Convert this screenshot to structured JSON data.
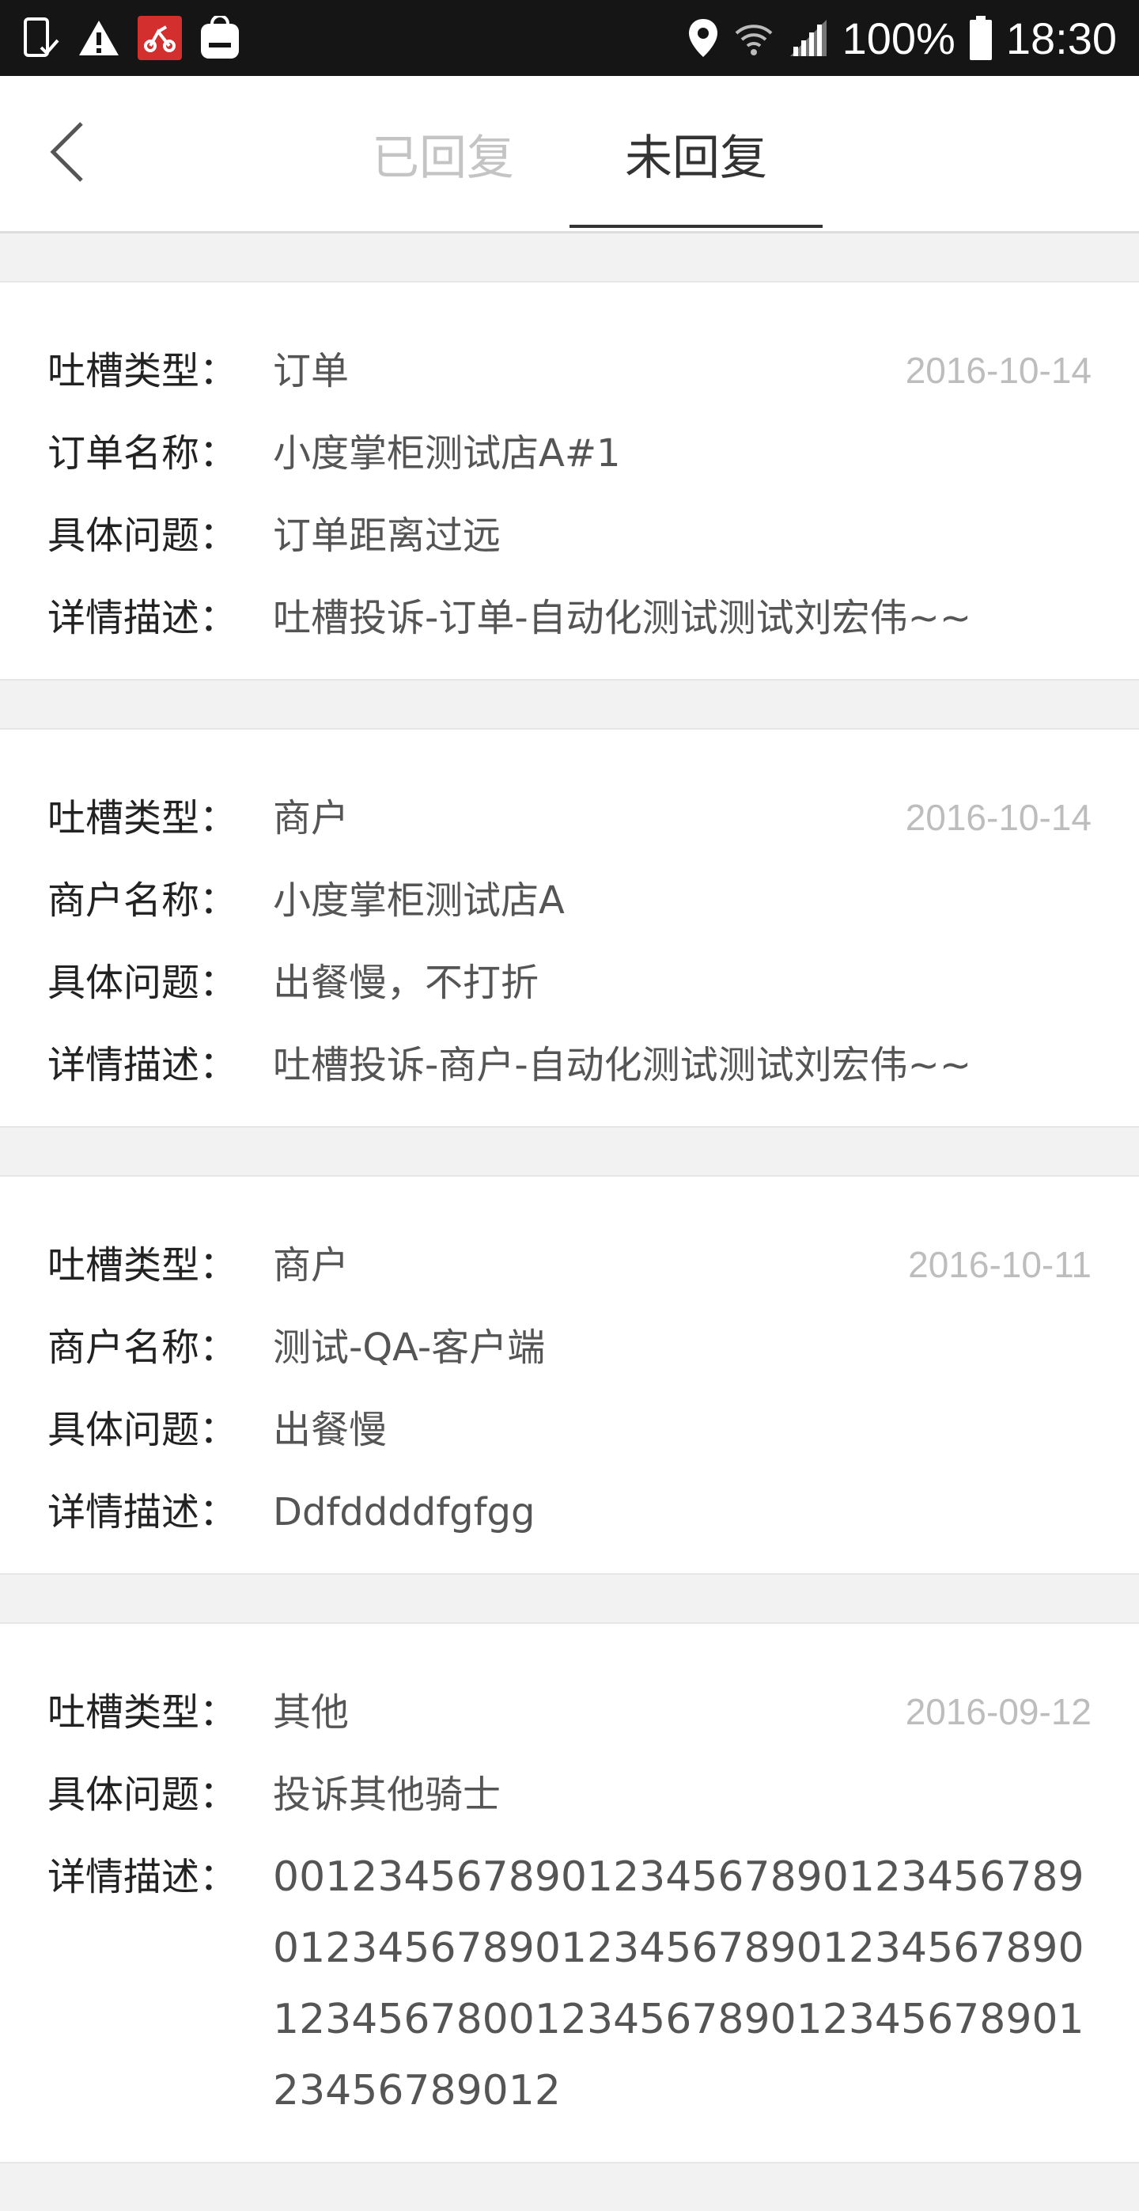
{
  "status_bar": {
    "battery": "100%",
    "time": "18:30"
  },
  "header": {
    "tabs": [
      {
        "label": "已回复",
        "active": false
      },
      {
        "label": "未回复",
        "active": true
      }
    ]
  },
  "cards": [
    {
      "date": "2016-10-14",
      "rows": [
        {
          "label": "吐槽类型：",
          "value": "订单"
        },
        {
          "label": "订单名称：",
          "value": "小度掌柜测试店A#1"
        },
        {
          "label": "具体问题：",
          "value": "订单距离过远"
        },
        {
          "label": "详情描述：",
          "value": "吐槽投诉-订单-自动化测试测试刘宏伟~~"
        }
      ]
    },
    {
      "date": "2016-10-14",
      "rows": [
        {
          "label": "吐槽类型：",
          "value": "商户"
        },
        {
          "label": "商户名称：",
          "value": "小度掌柜测试店A"
        },
        {
          "label": "具体问题：",
          "value": "出餐慢，不打折"
        },
        {
          "label": "详情描述：",
          "value": "吐槽投诉-商户-自动化测试测试刘宏伟~~"
        }
      ]
    },
    {
      "date": "2016-10-11",
      "rows": [
        {
          "label": "吐槽类型：",
          "value": "商户"
        },
        {
          "label": "商户名称：",
          "value": "测试-QA-客户端"
        },
        {
          "label": "具体问题：",
          "value": "出餐慢"
        },
        {
          "label": "详情描述：",
          "value": "Ddfddddfgfgg"
        }
      ]
    },
    {
      "date": "2016-09-12",
      "rows": [
        {
          "label": "吐槽类型：",
          "value": "其他"
        },
        {
          "label": "具体问题：",
          "value": "投诉其他骑士"
        },
        {
          "label": "详情描述：",
          "value": "00123456789012345678901234567890123456789012345678901234567890123456780012345678901234567890123456789012"
        }
      ]
    }
  ],
  "colors": {
    "status_bar_bg": "#151515",
    "active_tab": "#333333",
    "inactive_tab": "#c4c4c4",
    "date": "#bdbdbd",
    "background": "#f2f2f2"
  }
}
